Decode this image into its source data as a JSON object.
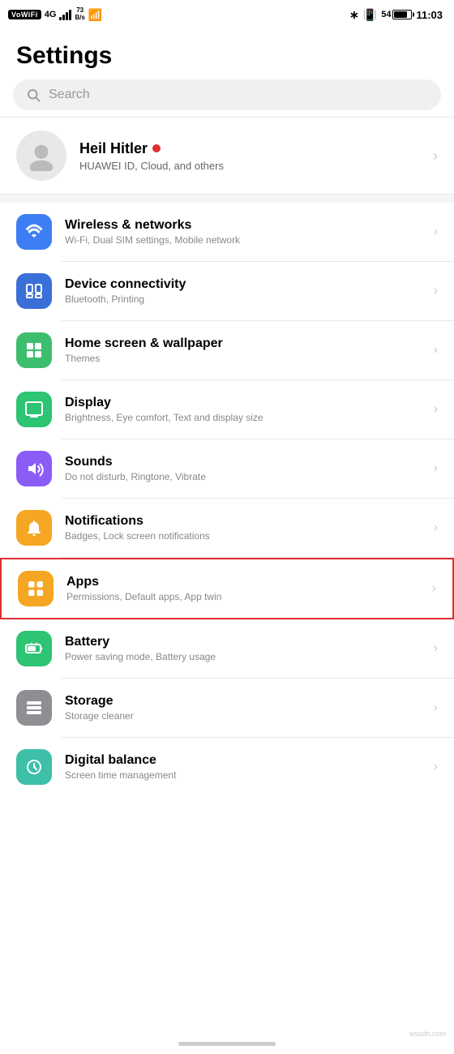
{
  "statusBar": {
    "left": {
      "vowifi": "VoWiFi",
      "network": "4G",
      "bars": 3,
      "speed": "73\nB/s"
    },
    "right": {
      "bluetooth": "bluetooth",
      "vibrate": "vibrate",
      "battery": 54,
      "time": "11:03"
    }
  },
  "pageTitle": "Settings",
  "search": {
    "placeholder": "Search"
  },
  "profile": {
    "name": "Heil Hitler",
    "hasOnlineDot": true,
    "subtitle": "HUAWEI ID, Cloud, and others"
  },
  "items": [
    {
      "id": "wireless-networks",
      "iconColor": "icon-blue",
      "iconSymbol": "wifi",
      "title": "Wireless & networks",
      "subtitle": "Wi-Fi, Dual SIM settings, Mobile network",
      "highlighted": false
    },
    {
      "id": "device-connectivity",
      "iconColor": "icon-blue2",
      "iconSymbol": "device",
      "title": "Device connectivity",
      "subtitle": "Bluetooth, Printing",
      "highlighted": false
    },
    {
      "id": "home-screen",
      "iconColor": "icon-green",
      "iconSymbol": "home",
      "title": "Home screen & wallpaper",
      "subtitle": "Themes",
      "highlighted": false
    },
    {
      "id": "display",
      "iconColor": "icon-green2",
      "iconSymbol": "display",
      "title": "Display",
      "subtitle": "Brightness, Eye comfort, Text and display size",
      "highlighted": false
    },
    {
      "id": "sounds",
      "iconColor": "icon-purple",
      "iconSymbol": "sounds",
      "title": "Sounds",
      "subtitle": "Do not disturb, Ringtone, Vibrate",
      "highlighted": false
    },
    {
      "id": "notifications",
      "iconColor": "icon-yellow",
      "iconSymbol": "notifications",
      "title": "Notifications",
      "subtitle": "Badges, Lock screen notifications",
      "highlighted": false
    },
    {
      "id": "apps",
      "iconColor": "icon-orange",
      "iconSymbol": "apps",
      "title": "Apps",
      "subtitle": "Permissions, Default apps, App twin",
      "highlighted": true
    },
    {
      "id": "battery",
      "iconColor": "icon-green2",
      "iconSymbol": "battery",
      "title": "Battery",
      "subtitle": "Power saving mode, Battery usage",
      "highlighted": false
    },
    {
      "id": "storage",
      "iconColor": "icon-gray",
      "iconSymbol": "storage",
      "title": "Storage",
      "subtitle": "Storage cleaner",
      "highlighted": false
    },
    {
      "id": "digital-balance",
      "iconColor": "icon-teal2",
      "iconSymbol": "digital",
      "title": "Digital balance",
      "subtitle": "Screen time management",
      "highlighted": false
    }
  ],
  "watermark": "wsxdn.com"
}
